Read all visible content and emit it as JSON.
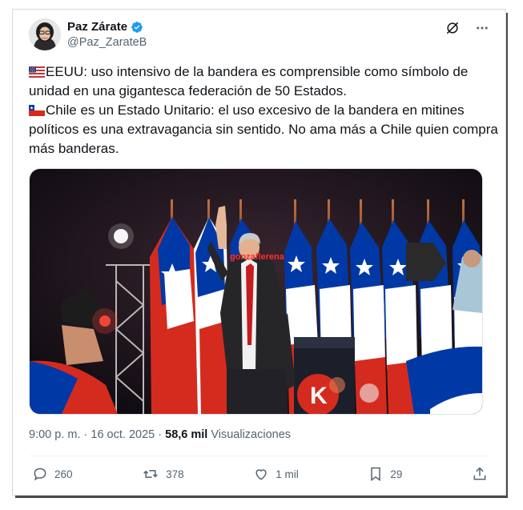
{
  "author": {
    "display_name": "Paz Zárate",
    "handle": "@Paz_ZarateB",
    "verified_color": "#1d9bf0"
  },
  "post": {
    "paragraph1": "EEUU: uso intensivo de la bandera es comprensible como símbolo de unidad en una gigantesca federación de 50 Estados.",
    "paragraph1_flag": "us-flag-emoji",
    "paragraph2": "Chile es un Estado Unitario: el uso excesivo de la bandera en mitines políticos es una extravagancia sin sentido. No ama más a Chile quien compra más banderas.",
    "paragraph2_flag": "chile-flag-emoji",
    "image_overlay_text": "gonzaflerena",
    "podium_letter": "K"
  },
  "meta": {
    "time": "9:00 p. m.",
    "separator": "·",
    "date": "16 oct. 2025",
    "views_count": "58,6 mil",
    "views_label": "Visualizaciones"
  },
  "actions": {
    "replies": "260",
    "reposts": "378",
    "likes": "1 mil",
    "bookmarks": "29"
  },
  "colors": {
    "text_primary": "#0f1419",
    "text_secondary": "#536471",
    "chile_red": "#d52b1e",
    "chile_blue": "#0039a6"
  }
}
